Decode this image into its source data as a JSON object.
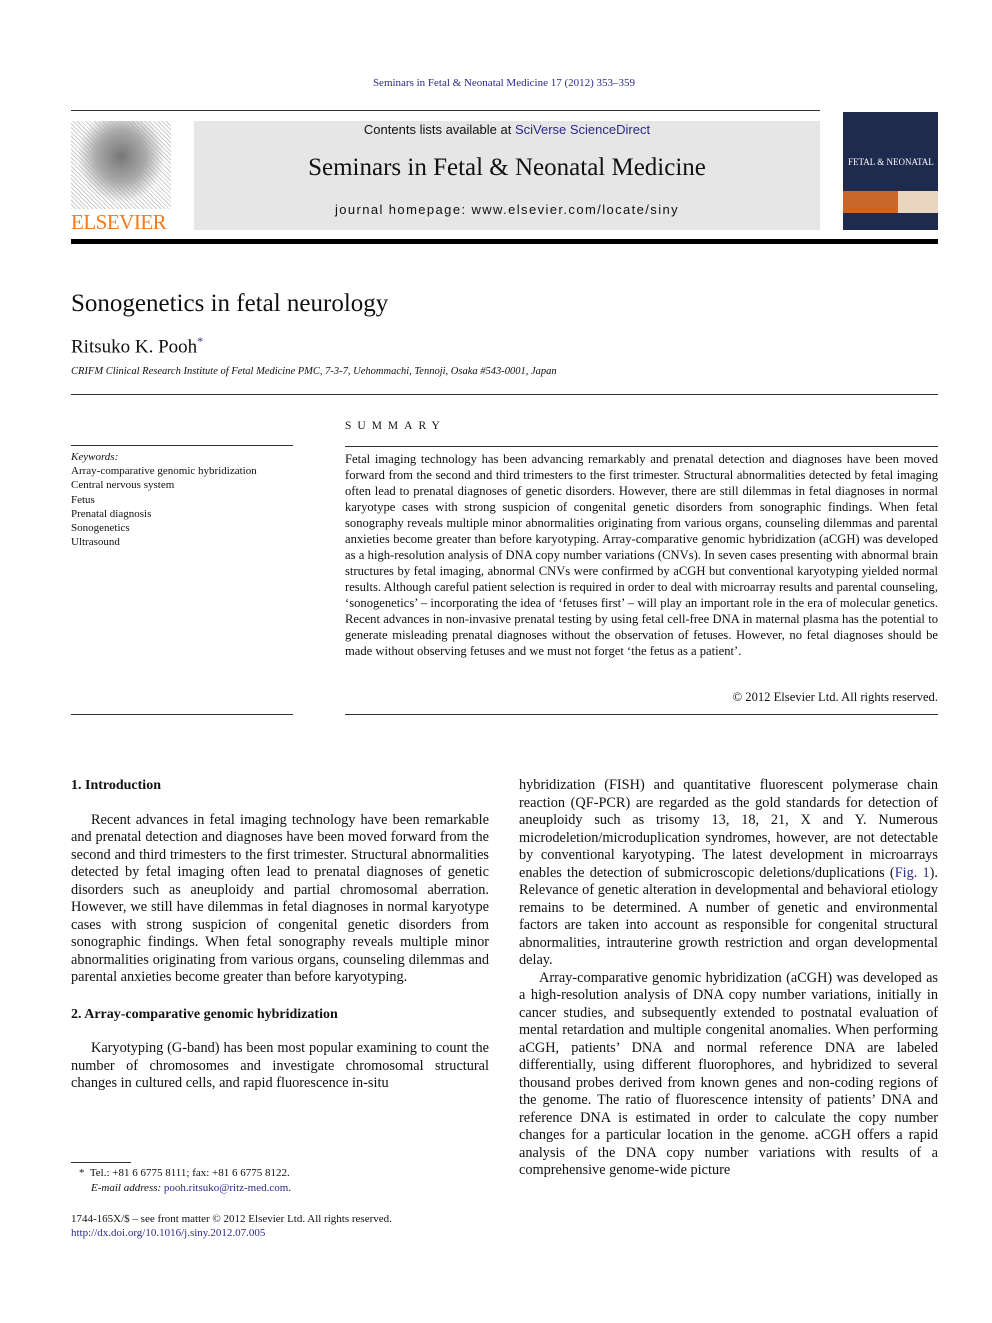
{
  "header": {
    "citation": "Seminars in Fetal & Neonatal Medicine 17 (2012) 353–359",
    "contents_prefix": "Contents lists available at ",
    "contents_link": "SciVerse ScienceDirect",
    "journal_title": "Seminars in Fetal & Neonatal Medicine",
    "homepage": "journal homepage: www.elsevier.com/locate/siny",
    "publisher_logo": "ELSEVIER",
    "cover_text": "FETAL & NEONATAL"
  },
  "article": {
    "title": "Sonogenetics in fetal neurology",
    "author": "Ritsuko K. Pooh",
    "author_mark": "*",
    "affiliation": "CRIFM Clinical Research Institute of Fetal Medicine PMC, 7-3-7, Uehommachi, Tennoji, Osaka #543-0001, Japan"
  },
  "keywords": {
    "label": "Keywords:",
    "items": [
      "Array-comparative genomic hybridization",
      "Central nervous system",
      "Fetus",
      "Prenatal diagnosis",
      "Sonogenetics",
      "Ultrasound"
    ]
  },
  "summary": {
    "heading": "SUMMARY",
    "text": "Fetal imaging technology has been advancing remarkably and prenatal detection and diagnoses have been moved forward from the second and third trimesters to the first trimester. Structural abnormalities detected by fetal imaging often lead to prenatal diagnoses of genetic disorders. However, there are still dilemmas in fetal diagnoses in normal karyotype cases with strong suspicion of congenital genetic disorders from sonographic findings. When fetal sonography reveals multiple minor abnormalities originating from various organs, counseling dilemmas and parental anxieties become greater than before karyotyping. Array-comparative genomic hybridization (aCGH) was developed as a high-resolution analysis of DNA copy number variations (CNVs). In seven cases presenting with abnormal brain structures by fetal imaging, abnormal CNVs were confirmed by aCGH but conventional karyotyping yielded normal results. Although careful patient selection is required in order to deal with microarray results and parental counseling, ‘sonogenetics’ – incorporating the idea of ‘fetuses first’ – will play an important role in the era of molecular genetics. Recent advances in non-invasive prenatal testing by using fetal cell-free DNA in maternal plasma has the potential to generate misleading prenatal diagnoses without the observation of fetuses. However, no fetal diagnoses should be made without observing fetuses and we must not forget ‘the fetus as a patient’.",
    "copyright": "© 2012 Elsevier Ltd. All rights reserved."
  },
  "body": {
    "s1_heading": "1.  Introduction",
    "s1_p1": "Recent advances in fetal imaging technology have been remarkable and prenatal detection and diagnoses have been moved forward from the second and third trimesters to the first trimester. Structural abnormalities detected by fetal imaging often lead to prenatal diagnoses of genetic disorders such as aneuploidy and partial chromosomal aberration. However, we still have dilemmas in fetal diagnoses in normal karyotype cases with strong suspicion of congenital genetic disorders from sonographic findings. When fetal sonography reveals multiple minor abnormalities originating from various organs, counseling dilemmas and parental anxieties become greater than before karyotyping.",
    "s2_heading": "2.  Array-comparative genomic hybridization",
    "s2_p1_a": "Karyotyping (G-band) has been most popular examining to count the number of chromosomes and investigate chromosomal structural changes in cultured cells, and rapid fluorescence in-situ",
    "s2_p1_b": "hybridization (FISH) and quantitative fluorescent polymerase chain reaction (QF-PCR) are regarded as the gold standards for detection of aneuploidy such as trisomy 13, 18, 21, X and Y. Numerous microdeletion/microduplication syndromes, however, are not detectable by conventional karyotyping. The latest development in microarrays enables the detection of submicroscopic deletions/duplications (",
    "s2_p1_link": "Fig. 1",
    "s2_p1_c": "). Relevance of genetic alteration in developmental and behavioral etiology remains to be determined. A number of genetic and environmental factors are taken into account as responsible for congenital structural abnormalities, intrauterine growth restriction and organ developmental delay.",
    "s2_p2": "Array-comparative genomic hybridization (aCGH) was developed as a high-resolution analysis of DNA copy number variations, initially in cancer studies, and subsequently extended to postnatal evaluation of mental retardation and multiple congenital anomalies. When performing aCGH, patients’ DNA and normal reference DNA are labeled differentially, using different fluorophores, and hybridized to several thousand probes derived from known genes and non-coding regions of the genome. The ratio of fluorescence intensity of patients’ DNA and reference DNA is estimated in order to calculate the copy number changes for a particular location in the genome. aCGH offers a rapid analysis of the DNA copy number variations with results of a comprehensive genome-wide picture"
  },
  "footnote": {
    "mark": "*",
    "tel": "Tel.: +81 6 6775 8111; fax: +81 6 6775 8122.",
    "email_label": "E-mail address:",
    "email": "pooh.ritsuko@ritz-med.com",
    "front_matter": "1744-165X/$ – see front matter © 2012 Elsevier Ltd. All rights reserved.",
    "doi": "http://dx.doi.org/10.1016/j.siny.2012.07.005"
  },
  "colors": {
    "link": "#2a2a8a",
    "elsevier_orange": "#f07a1c",
    "banner_bg": "#e6e6e6",
    "cover_bg": "#1f2a4f"
  }
}
